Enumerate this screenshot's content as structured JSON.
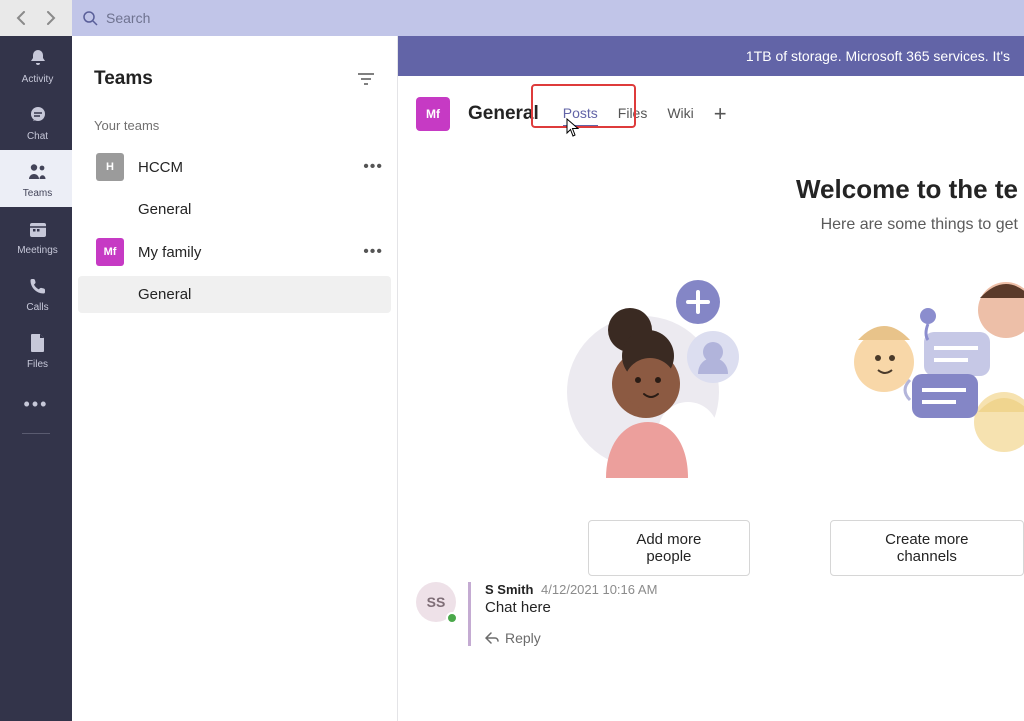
{
  "search": {
    "placeholder": "Search"
  },
  "banner": {
    "text": "1TB of storage. Microsoft 365 services. It's "
  },
  "rail": {
    "activity": "Activity",
    "chat": "Chat",
    "teams": "Teams",
    "meetings": "Meetings",
    "calls": "Calls",
    "files": "Files"
  },
  "panel": {
    "title": "Teams",
    "section_label": "Your teams",
    "teams": [
      {
        "initial": "H",
        "name": "HCCM",
        "channel": "General"
      },
      {
        "initial": "Mf",
        "name": "My family",
        "channel": "General"
      }
    ]
  },
  "header": {
    "team_initial": "Mf",
    "channel_name": "General",
    "tabs": {
      "posts": "Posts",
      "files": "Files",
      "wiki": "Wiki"
    }
  },
  "welcome": {
    "title": "Welcome to the te",
    "subtitle": "Here are some things to get"
  },
  "actions": {
    "add_people": "Add more people",
    "create_channels": "Create more channels"
  },
  "thread": {
    "avatar_initials": "SS",
    "author": "S Smith",
    "timestamp": "4/12/2021 10:16 AM",
    "message": "Chat here",
    "reply_label": "Reply"
  }
}
